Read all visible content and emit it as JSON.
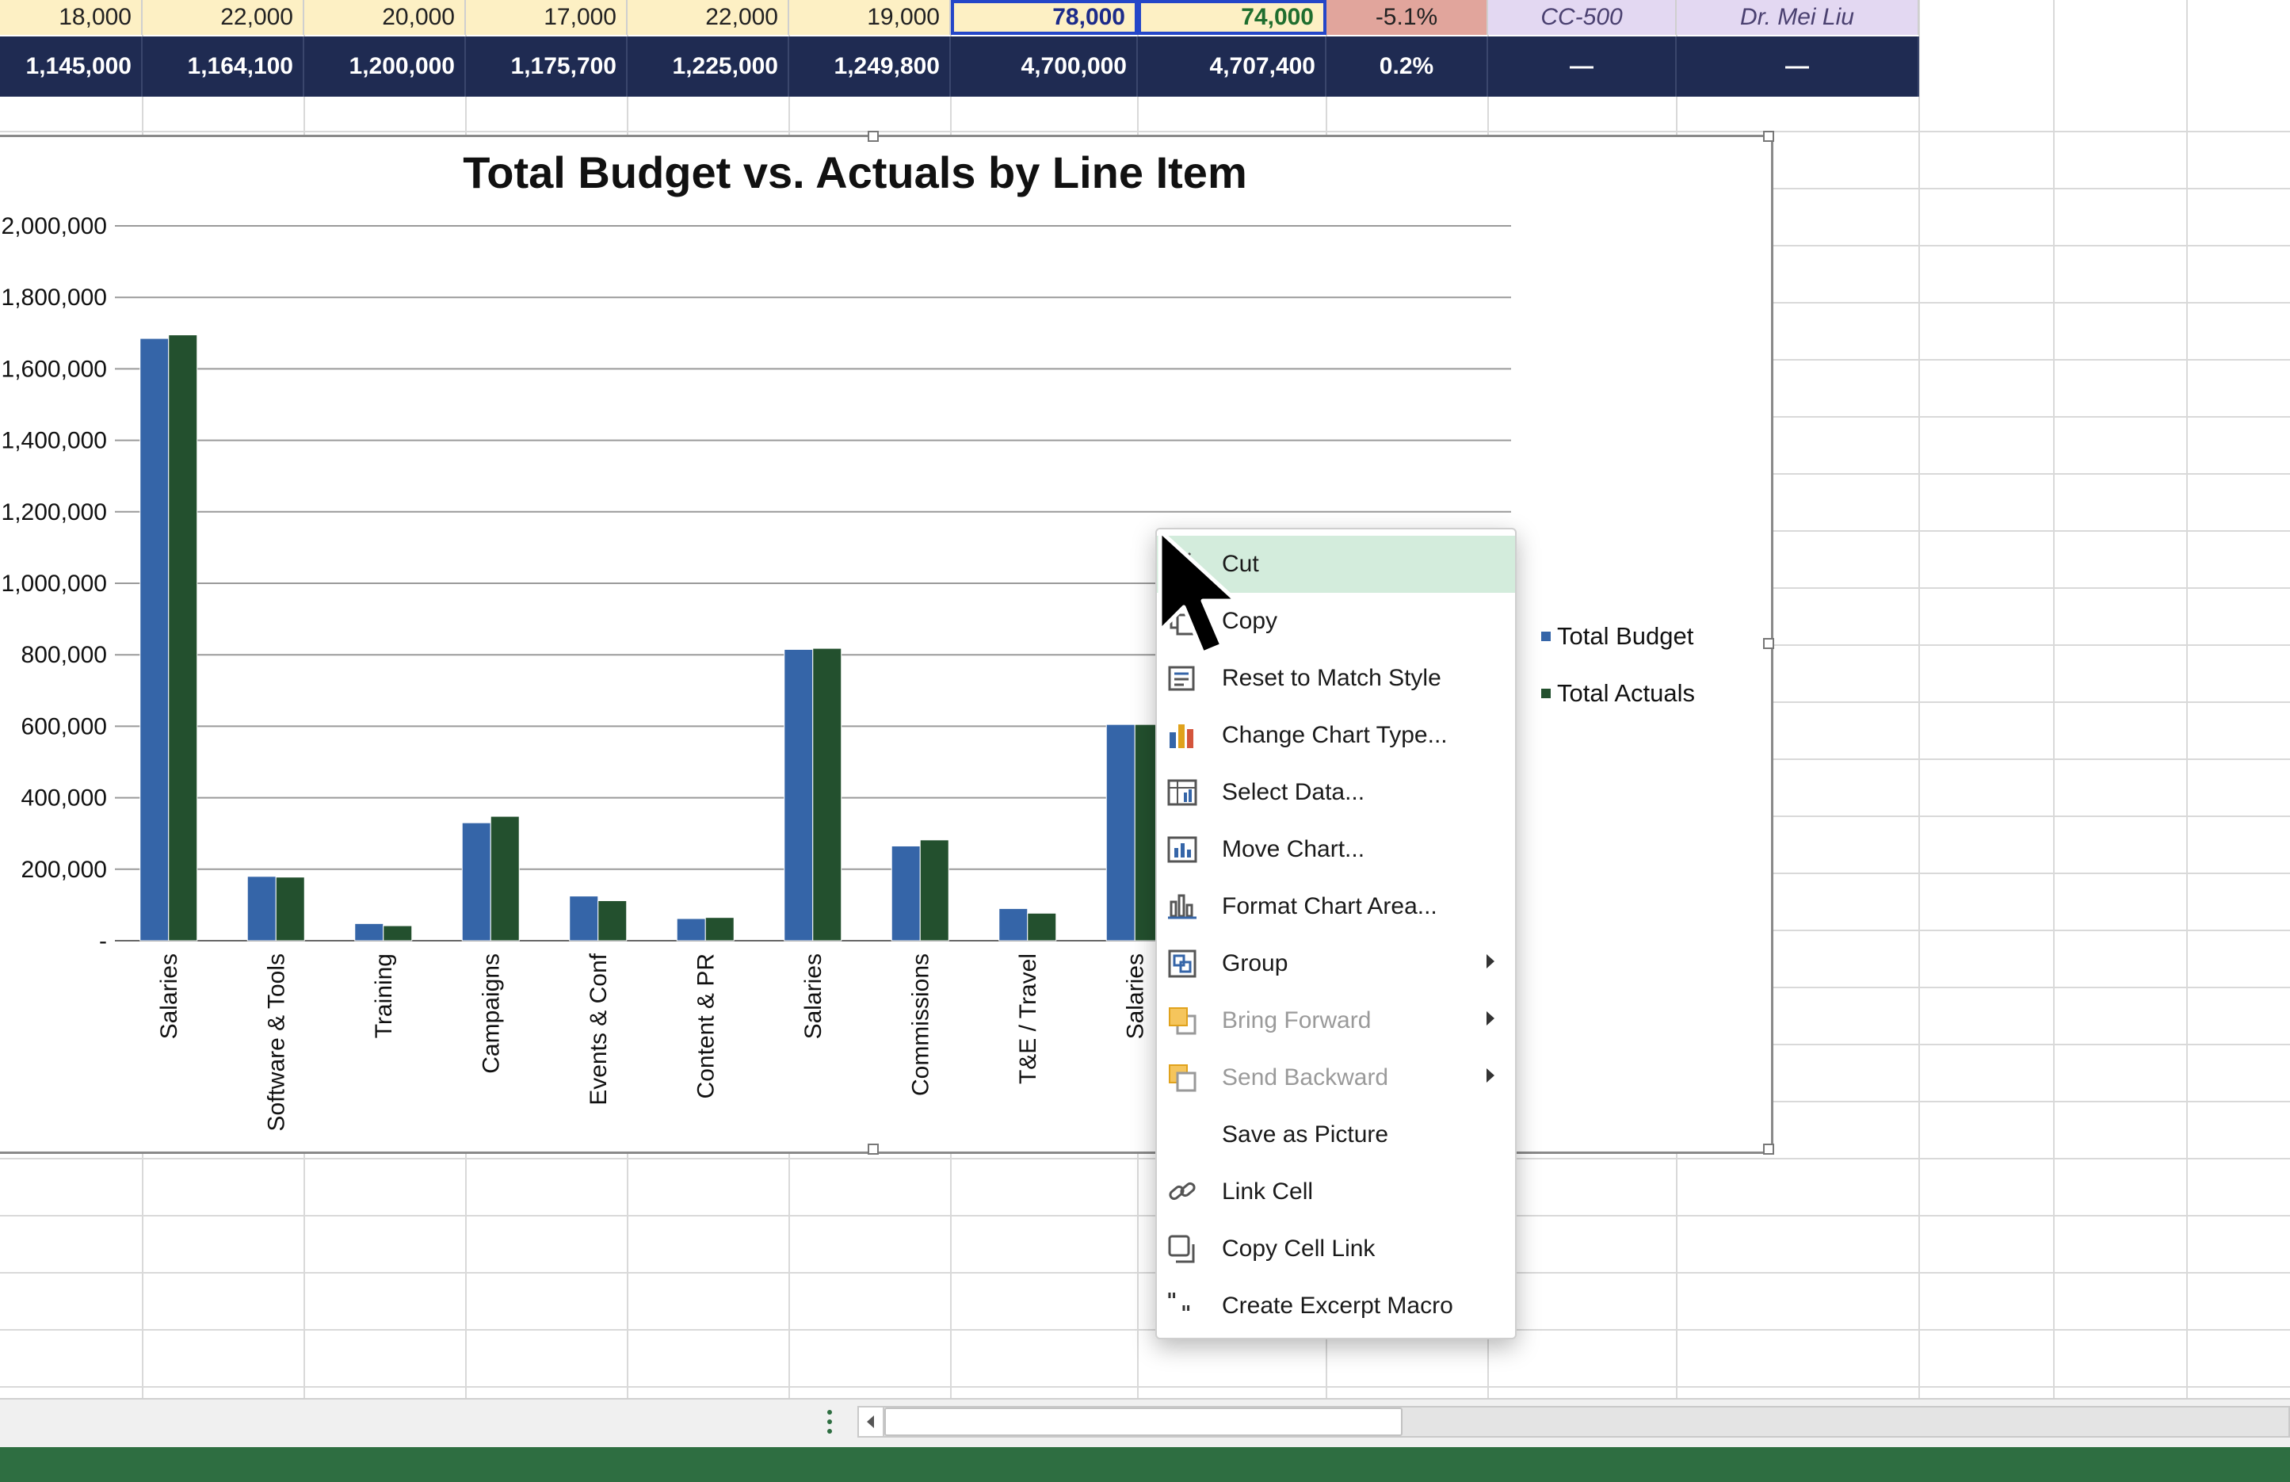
{
  "rows": {
    "row1": [
      "18,000",
      "22,000",
      "20,000",
      "17,000",
      "22,000",
      "19,000",
      "78,000",
      "74,000",
      "-5.1%",
      "CC-500",
      "Dr. Mei Liu"
    ],
    "row2": [
      "1,145,000",
      "1,164,100",
      "1,200,000",
      "1,175,700",
      "1,225,000",
      "1,249,800",
      "4,700,000",
      "4,707,400",
      "0.2%",
      "—",
      "—"
    ]
  },
  "colors": {
    "budget": "#3565a8",
    "actuals": "#23502e",
    "header_navy": "#1f2b52",
    "row_yellow": "#fdf0c4",
    "variance_red": "#e1a59c",
    "cc_purple": "#e3d8f2",
    "menu_highlight": "#d3ecdc",
    "status_green": "#2e6e41"
  },
  "chart_data": {
    "type": "bar",
    "title": "Total Budget vs. Actuals by Line Item",
    "categories": [
      "Salaries",
      "Software & Tools",
      "Training",
      "Campaigns",
      "Events & Conf",
      "Content & PR",
      "Salaries",
      "Commissions",
      "T&E / Travel",
      "Salaries"
    ],
    "series": [
      {
        "name": "Total Budget",
        "values": [
          1685000,
          180000,
          48000,
          330000,
          125000,
          62000,
          815000,
          265000,
          90000,
          605000
        ]
      },
      {
        "name": "Total Actuals",
        "values": [
          1695000,
          178000,
          42000,
          348000,
          112000,
          65000,
          818000,
          282000,
          77000,
          605000
        ]
      }
    ],
    "y_ticks": [
      "-",
      "200,000",
      "400,000",
      "600,000",
      "800,000",
      "1,000,000",
      "1,200,000",
      "1,400,000",
      "1,600,000",
      "1,800,000",
      "2,000,000"
    ],
    "ylim": [
      0,
      2000000
    ],
    "grid": true,
    "legend": "right"
  },
  "context_menu": {
    "items": [
      {
        "label": "Cut",
        "icon": "scissors-icon",
        "state": "highlighted"
      },
      {
        "label": "Copy",
        "icon": "copy-icon"
      },
      {
        "label": "Reset to Match Style",
        "icon": "reset-style-icon"
      },
      {
        "label": "Change Chart Type...",
        "icon": "chart-type-icon"
      },
      {
        "label": "Select Data...",
        "icon": "select-data-icon"
      },
      {
        "label": "Move Chart...",
        "icon": "move-chart-icon"
      },
      {
        "label": "Format Chart Area...",
        "icon": "format-chart-icon"
      },
      {
        "label": "Group",
        "icon": "group-icon",
        "submenu": true
      },
      {
        "label": "Bring Forward",
        "icon": "bring-forward-icon",
        "submenu": true,
        "disabled": true
      },
      {
        "label": "Send Backward",
        "icon": "send-backward-icon",
        "submenu": true,
        "disabled": true
      },
      {
        "label": "Save as Picture",
        "icon": ""
      },
      {
        "label": "Link Cell",
        "icon": "link-icon"
      },
      {
        "label": "Copy Cell Link",
        "icon": "copy-link-icon"
      },
      {
        "label": "Create Excerpt Macro",
        "icon": "quote-icon"
      }
    ]
  }
}
